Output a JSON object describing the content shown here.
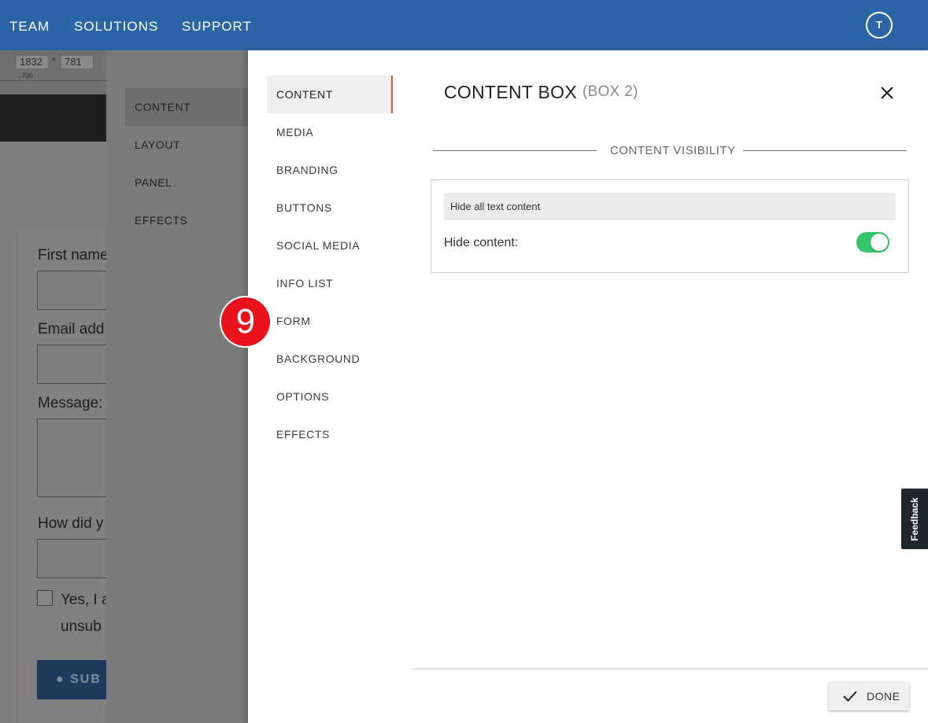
{
  "topbar": {
    "nav": [
      "TEAM",
      "SOLUTIONS",
      "SUPPORT"
    ],
    "avatar_initial": "T",
    "color": "#2c65a6"
  },
  "background_page": {
    "ruler": {
      "width": "1832",
      "times": "×",
      "height": "781",
      "tick_label": "700"
    },
    "form": {
      "labels": [
        "First name",
        "Email add",
        "Message:",
        "How did y"
      ],
      "checkbox_text": [
        "Yes, I a",
        "unsub"
      ],
      "submit_label": "SUB"
    }
  },
  "outer_sidebar": {
    "items": [
      {
        "label": "CONTENT",
        "active": true
      },
      {
        "label": "LAYOUT",
        "active": false
      },
      {
        "label": "PANEL",
        "active": false
      },
      {
        "label": "EFFECTS",
        "active": false
      }
    ]
  },
  "panel": {
    "nav": [
      {
        "label": "CONTENT",
        "active": true
      },
      {
        "label": "MEDIA",
        "active": false
      },
      {
        "label": "BRANDING",
        "active": false
      },
      {
        "label": "BUTTONS",
        "active": false
      },
      {
        "label": "SOCIAL MEDIA",
        "active": false
      },
      {
        "label": "INFO LIST",
        "active": false
      },
      {
        "label": "FORM",
        "active": false
      },
      {
        "label": "BACKGROUND",
        "active": false
      },
      {
        "label": "OPTIONS",
        "active": false
      },
      {
        "label": "EFFECTS",
        "active": false
      }
    ],
    "title": "CONTENT BOX",
    "subtitle": "(BOX 2)",
    "section_title": "CONTENT VISIBILITY",
    "visibility": {
      "hint": "Hide all text content",
      "label": "Hide content:",
      "toggle_on": true,
      "toggle_color": "#34c46a"
    },
    "done_label": "DONE",
    "accent_color": "#e0552a"
  },
  "feedback_tab": "Feedback",
  "step_badge": "9"
}
